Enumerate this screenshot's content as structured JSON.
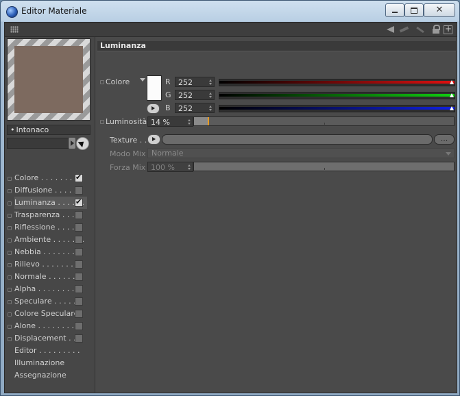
{
  "window": {
    "title": "Editor Materiale",
    "close_glyph": "✕"
  },
  "toolbar": {
    "icons": [
      "grip-icon",
      "arrow-back-icon",
      "arrow-forward-icon",
      "pin-icon",
      "lock-icon",
      "new-panel-icon"
    ]
  },
  "material": {
    "name": "Intonaco",
    "preview_color": "#7d6a5f"
  },
  "channels": [
    {
      "label": "Colore . . . . . . . . .",
      "checked": true
    },
    {
      "label": "Diffusione . . . . . .",
      "checked": false
    },
    {
      "label": "Luminanza . . . . . .",
      "checked": true,
      "active": true
    },
    {
      "label": "Trasparenza . . . .",
      "checked": false
    },
    {
      "label": "Riflessione . . . . .",
      "checked": false
    },
    {
      "label": "Ambiente . . . . . . .",
      "checked": false
    },
    {
      "label": "Nebbia . . . . . . . .",
      "checked": false
    },
    {
      "label": "Rilievo . . . . . . . .",
      "checked": false
    },
    {
      "label": "Normale . . . . . . .",
      "checked": false
    },
    {
      "label": "Alpha . . . . . . . . .",
      "checked": false
    },
    {
      "label": "Speculare . . . . . .",
      "checked": false
    },
    {
      "label": "Colore Speculare",
      "checked": false
    },
    {
      "label": "Alone . . . . . . . . .",
      "checked": false
    },
    {
      "label": "Displacement . . .",
      "checked": false
    }
  ],
  "extra_items": [
    {
      "label": "Editor . . . . . . . . ."
    },
    {
      "label": "Illuminazione"
    },
    {
      "label": "Assegnazione"
    }
  ],
  "panel": {
    "section_title": "Luminanza",
    "color_label": "Colore",
    "swatch_color": "#fcfcfc",
    "r_label": "R",
    "r_value": "252",
    "g_label": "G",
    "g_value": "252",
    "b_label": "B",
    "b_value": "252",
    "luminosity_label": "Luminosità",
    "luminosity_value": "14 %",
    "luminosity_fraction": 0.14,
    "texture_label": "Texture . . .",
    "texture_more_label": "...",
    "mix_mode_label": "Modo Mix",
    "mix_mode_value": "Normale",
    "mix_strength_label": "Forza Mix",
    "mix_strength_value": "100 %",
    "mix_strength_fraction": 1.0
  },
  "colors": {
    "red_channel": "#e01010",
    "green_channel": "#10d010",
    "blue_channel": "#1020e0",
    "accent_marker": "#e89a1f"
  }
}
